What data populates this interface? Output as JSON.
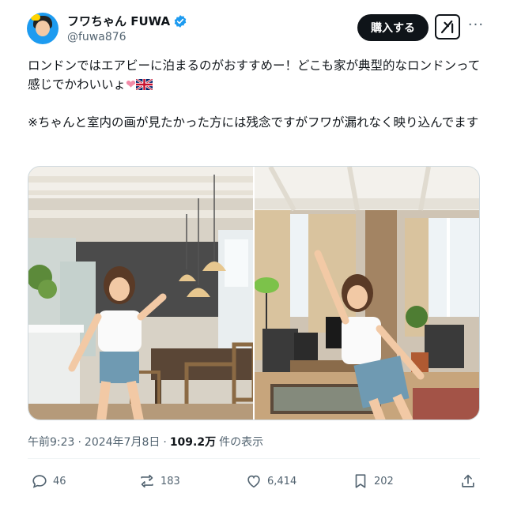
{
  "author": {
    "display_name": "フワちゃん FUWA",
    "handle": "@fuwa876",
    "avatar_icon": "avatar-image",
    "verified_color": "#1d9bf0"
  },
  "header": {
    "subscribe_label": "購入する",
    "grok_icon": "grok-icon",
    "more_label": "···"
  },
  "tweet": {
    "paragraph1": "ロンドンではエアビーに泊まるのがおすすめー！どこも家が典型的なロンドンって感じでかわいいょ",
    "heart": "❤",
    "paragraph2": "※ちゃんと室内の画が見たかった方には残念ですがフワが漏れなく映り込んでます"
  },
  "meta": {
    "time": "午前9:23",
    "separator": "·",
    "date": "2024年7月8日",
    "separator2": "·",
    "views": "109.2万",
    "views_label": "件の表示"
  },
  "actions": {
    "replies": "46",
    "reposts": "183",
    "likes": "6,414",
    "bookmarks": "202"
  }
}
